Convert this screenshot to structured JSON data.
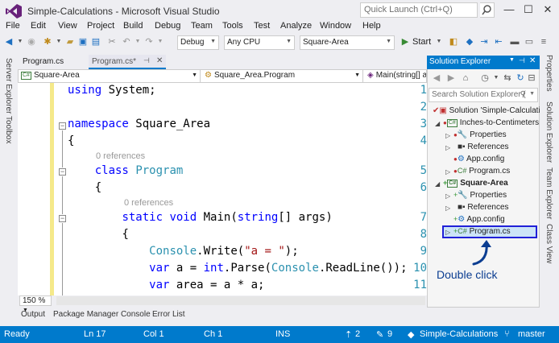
{
  "window": {
    "title": "Simple-Calculations - Microsoft Visual Studio",
    "quick_launch_placeholder": "Quick Launch (Ctrl+Q)"
  },
  "menu": [
    "File",
    "Edit",
    "View",
    "Project",
    "Build",
    "Debug",
    "Team",
    "Tools",
    "Test",
    "Analyze",
    "Window",
    "Help"
  ],
  "toolbar": {
    "config": "Debug",
    "platform": "Any CPU",
    "startup_project": "Square-Area",
    "start_label": "Start"
  },
  "left_strip": [
    "Server Explorer",
    "Toolbox"
  ],
  "right_strip": [
    "Properties",
    "Solution Explorer",
    "Team Explorer",
    "Class View"
  ],
  "doc_tabs": [
    {
      "label": "Program.cs"
    },
    {
      "label": "Program.cs*"
    }
  ],
  "nav_bar": {
    "project": "Square-Area",
    "type": "Square_Area.Program",
    "member": "Main(string[] a"
  },
  "code": {
    "line_numbers": [
      "1",
      "2",
      "3",
      "4",
      "5",
      "6",
      "7",
      "8",
      "9",
      "10",
      "11"
    ],
    "ref_label": "0 references",
    "using": "using",
    "system": "System;",
    "namespace_kw": "namespace",
    "namespace_name": "Square_Area",
    "brace_open": "{",
    "class_kw": "class",
    "class_name": "Program",
    "static_kw": "static",
    "void_kw": "void",
    "main_name": "Main(",
    "string_kw": "string",
    "main_args": "[] args)",
    "console": "Console",
    "write": ".Write(",
    "str_a": "\"a = \"",
    "close_stmt": ");",
    "var_kw": "var",
    "a_assign": " a = ",
    "int_kw": "int",
    "parse": ".Parse(",
    "readline": ".ReadLine());",
    "area_assign": " area = a * a;"
  },
  "zoom": "150 %",
  "bottom_tabs": [
    "Output",
    "Package Manager Console",
    "Error List"
  ],
  "status": {
    "ready": "Ready",
    "ln": "Ln 17",
    "col": "Col 1",
    "ch": "Ch 1",
    "ins": "INS",
    "up": "2",
    "edits": "9",
    "repo": "Simple-Calculations",
    "branch": "master"
  },
  "solution_explorer": {
    "title": "Solution Explorer",
    "search_placeholder": "Search Solution Explorer (",
    "items": [
      {
        "label": "Solution 'Simple-Calculati"
      },
      {
        "label": "Inches-to-Centimeters"
      },
      {
        "label": "Properties"
      },
      {
        "label": "References"
      },
      {
        "label": "App.config"
      },
      {
        "label": "Program.cs"
      },
      {
        "label": "Square-Area"
      },
      {
        "label": "Properties"
      },
      {
        "label": "References"
      },
      {
        "label": "App.config"
      },
      {
        "label": "Program.cs"
      }
    ]
  },
  "annotation": "Double click",
  "colors": {
    "accent": "#007acc",
    "keyword": "#0000ff",
    "type": "#2b91af",
    "string": "#a31515",
    "annotation": "#0b3d91"
  }
}
